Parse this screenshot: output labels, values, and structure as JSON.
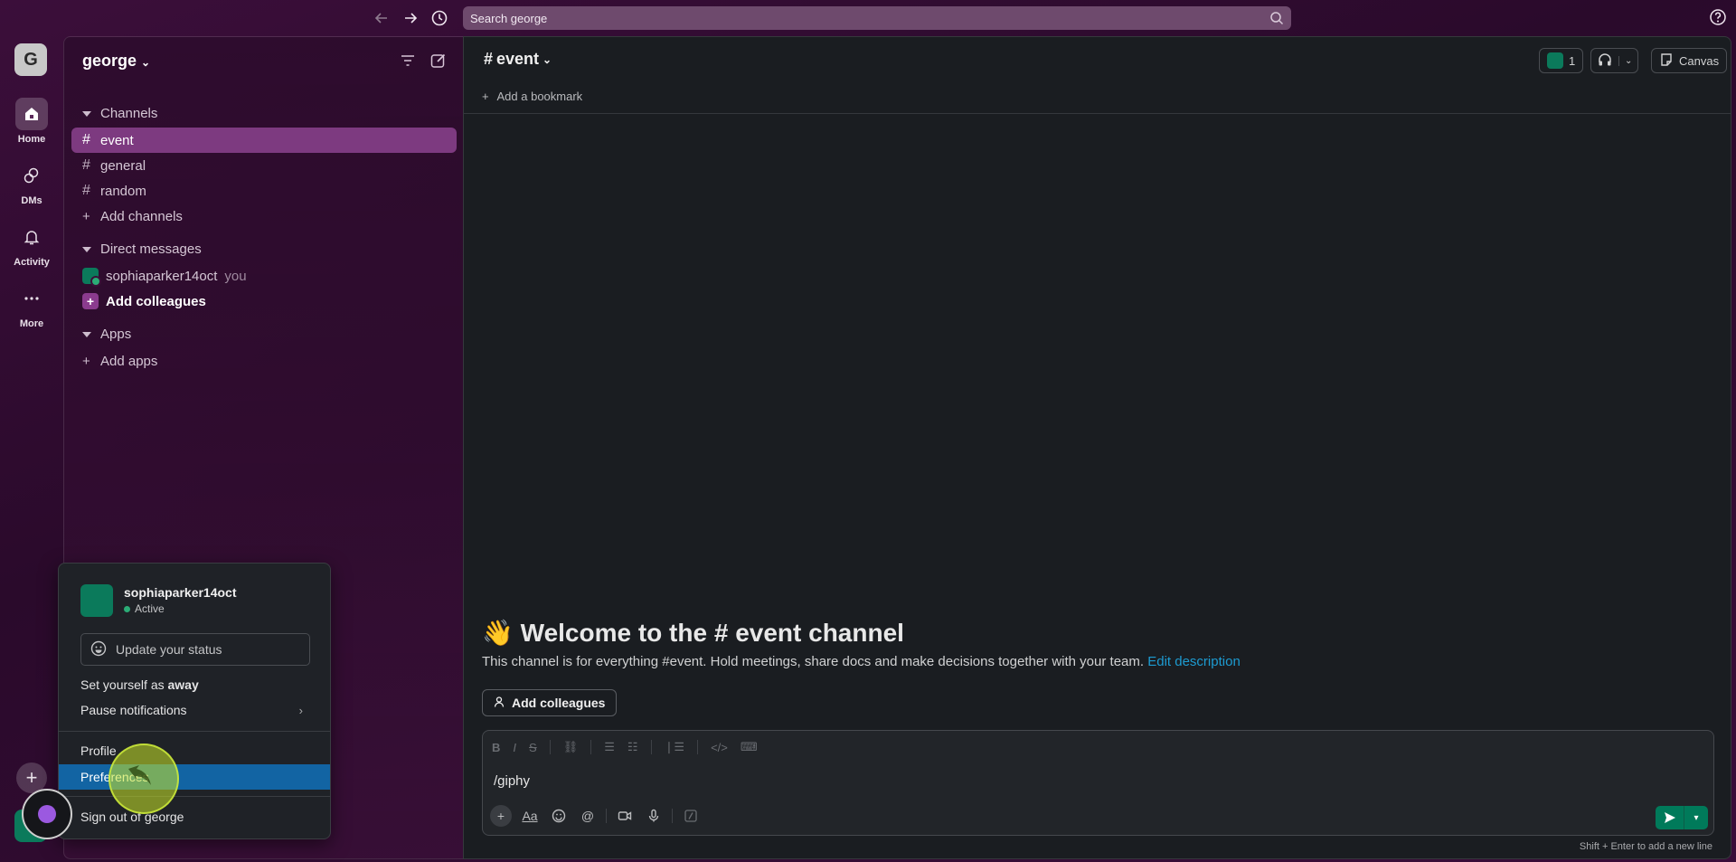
{
  "topbar": {
    "search_placeholder": "Search george",
    "back_icon": "arrow-left-icon",
    "forward_icon": "arrow-right-icon",
    "history_icon": "clock-icon",
    "help_icon": "help-icon"
  },
  "rail": {
    "workspace_initial": "G",
    "items": [
      {
        "label": "Home",
        "icon": "home-icon"
      },
      {
        "label": "DMs",
        "icon": "dms-icon"
      },
      {
        "label": "Activity",
        "icon": "bell-icon"
      },
      {
        "label": "More",
        "icon": "more-icon"
      }
    ],
    "plus": "+"
  },
  "sidebar": {
    "workspace_name": "george",
    "channels_header": "Channels",
    "channels": [
      "event",
      "general",
      "random"
    ],
    "add_channels": "Add channels",
    "dm_header": "Direct messages",
    "dm_user": "sophiaparker14oct",
    "dm_you": "you",
    "add_colleagues": "Add colleagues",
    "apps_header": "Apps",
    "add_apps": "Add apps",
    "hash": "#",
    "plus": "+"
  },
  "main": {
    "channel_title": "event",
    "member_count": "1",
    "canvas_label": "Canvas",
    "bookmark": "Add a bookmark",
    "welcome_emoji": "👋",
    "welcome_text": "Welcome to the # event channel",
    "welcome_desc": "This channel is for everything #event. Hold meetings, share docs and make decisions together with your team.",
    "edit_description": "Edit description",
    "add_colleagues_btn": "Add colleagues",
    "composer_text": "/giphy",
    "hint": "Shift + Enter to add a new line",
    "aa_label": "Aa"
  },
  "popup": {
    "username": "sophiaparker14oct",
    "status": "Active",
    "update_status": "Update your status",
    "set_away_prefix": "Set yourself as ",
    "set_away_bold": "away",
    "pause_notifications": "Pause notifications",
    "profile": "Profile",
    "preferences": "Preferences",
    "sign_out": "Sign out of george"
  },
  "colors": {
    "accent_active_channel": "#7d3a80",
    "menu_highlight": "#1264a3",
    "send_green": "#007a5a",
    "link": "#1d9bd1"
  }
}
